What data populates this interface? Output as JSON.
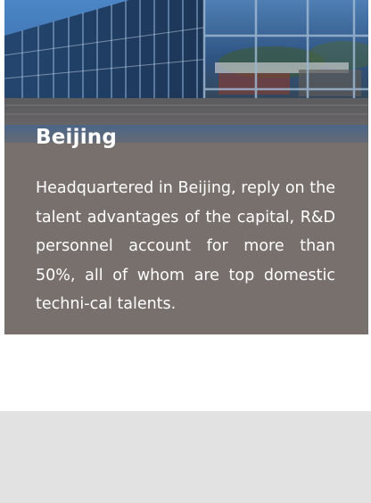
{
  "card": {
    "title": "Beijing",
    "description": "Headquartered in Beijing, reply on the talent advantages of the capital, R&D personnel account for more than 50%, all of whom are top domestic techni-cal talents."
  },
  "colors": {
    "card_overlay": "#77706c",
    "sky": "#3a6eb3",
    "glass": "#1f3f66",
    "gray_panel": "#e2e2e2",
    "text": "#ffffff"
  }
}
